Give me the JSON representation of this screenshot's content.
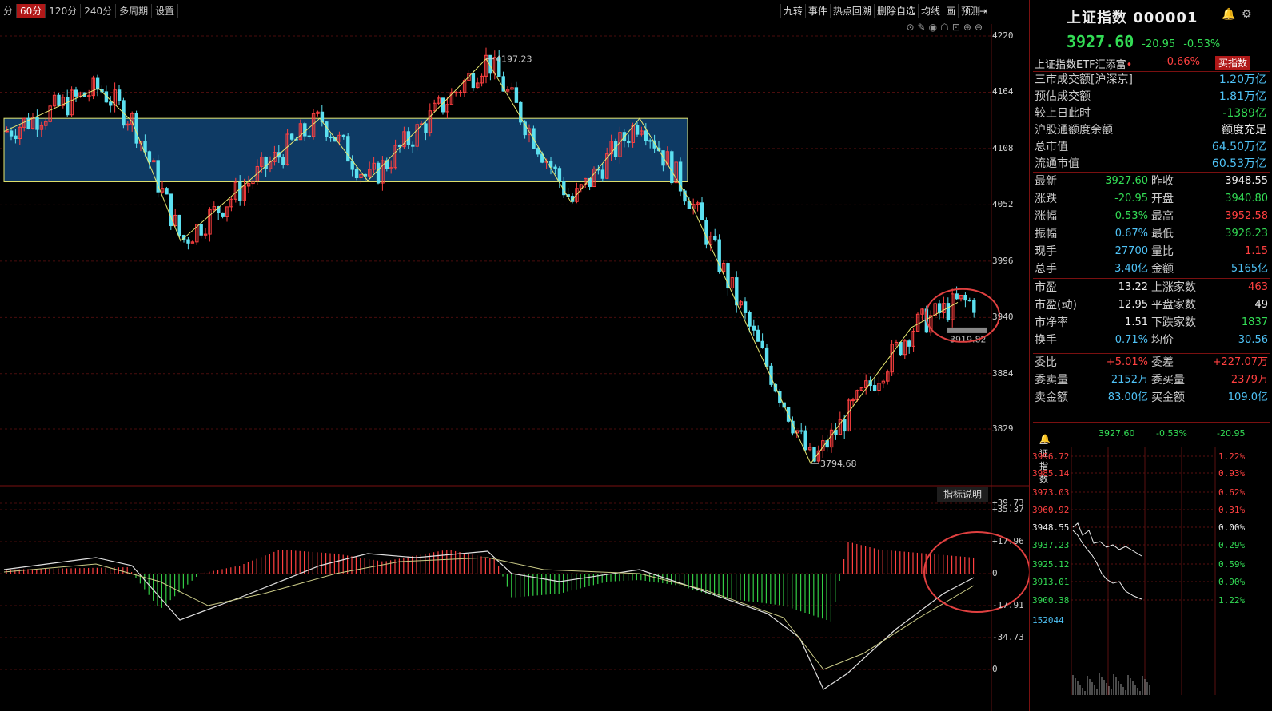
{
  "period_tabs": [
    {
      "label": "分"
    },
    {
      "label": "60分",
      "active": true
    },
    {
      "label": "120分"
    },
    {
      "label": "240分"
    },
    {
      "label": "多周期"
    },
    {
      "label": "设置"
    }
  ],
  "tool_tabs": [
    "九转",
    "事件",
    "热点回溯",
    "删除自选",
    "均线",
    "画",
    "预测"
  ],
  "tool_icons": [
    "⊙",
    "✎",
    "◉",
    "☖",
    "⊡",
    "⊕",
    "⊖"
  ],
  "price_axis": [
    "4220",
    "4164",
    "4108",
    "4052",
    "3996",
    "3940",
    "3884",
    "3829"
  ],
  "annotations": {
    "high": "4197.23",
    "low": "3794.68",
    "current_tag": "3919.82"
  },
  "indicator_axis": [
    "39.73",
    "35.37",
    "17.96",
    "0",
    "-17.91",
    "-34.73",
    "0"
  ],
  "indicator_button": "指标说明",
  "quote": {
    "title": "上证指数 000001",
    "price": "3927.60",
    "change": "-20.95",
    "change_pct": "-0.53%"
  },
  "etf": {
    "name": "上证指数ETF汇添富",
    "dot": "•",
    "change_pct": "-0.66%",
    "buy_label": "买指数"
  },
  "market_block": [
    {
      "k": "三市成交额[沪深京]",
      "v": "1.20万亿",
      "c": "cyan"
    },
    {
      "k": "预估成交额",
      "v": "1.81万亿",
      "c": "cyan"
    },
    {
      "k": "较上日此时",
      "v": "-1389亿",
      "c": "green"
    },
    {
      "k": "沪股通额度余额",
      "v": "额度充足",
      "c": "white"
    },
    {
      "k": "总市值",
      "v": "64.50万亿",
      "c": "cyan"
    },
    {
      "k": "流通市值",
      "v": "60.53万亿",
      "c": "cyan"
    }
  ],
  "stats_block": [
    {
      "k1": "最新",
      "v1": "3927.60",
      "c1": "green",
      "k2": "昨收",
      "v2": "3948.55",
      "c2": "white"
    },
    {
      "k1": "涨跌",
      "v1": "-20.95",
      "c1": "green",
      "k2": "开盘",
      "v2": "3940.80",
      "c2": "green"
    },
    {
      "k1": "涨幅",
      "v1": "-0.53%",
      "c1": "green",
      "k2": "最高",
      "v2": "3952.58",
      "c2": "red"
    },
    {
      "k1": "振幅",
      "v1": "0.67%",
      "c1": "cyan",
      "k2": "最低",
      "v2": "3926.23",
      "c2": "green"
    },
    {
      "k1": "现手",
      "v1": "27700",
      "c1": "cyan",
      "k2": "量比",
      "v2": "1.15",
      "c2": "red"
    },
    {
      "k1": "总手",
      "v1": "3.40亿",
      "c1": "cyan",
      "k2": "金额",
      "v2": "5165亿",
      "c2": "cyan"
    }
  ],
  "valuation_block": [
    {
      "k1": "市盈",
      "v1": "13.22",
      "c1": "white",
      "k2": "上涨家数",
      "v2": "463",
      "c2": "red"
    },
    {
      "k1": "市盈(动)",
      "v1": "12.95",
      "c1": "white",
      "k2": "平盘家数",
      "v2": "49",
      "c2": "white"
    },
    {
      "k1": "市净率",
      "v1": "1.51",
      "c1": "white",
      "k2": "下跌家数",
      "v2": "1837",
      "c2": "green"
    },
    {
      "k1": "换手",
      "v1": "0.71%",
      "c1": "cyan",
      "k2": "均价",
      "v2": "30.56",
      "c2": "cyan"
    }
  ],
  "order_block": [
    {
      "k1": "委比",
      "v1": "+5.01%",
      "c1": "red",
      "k2": "委差",
      "v2": "+227.07万",
      "c2": "red"
    },
    {
      "k1": "委卖量",
      "v1": "2152万",
      "c1": "cyan",
      "k2": "委买量",
      "v2": "2379万",
      "c2": "red"
    },
    {
      "k1": "卖金额",
      "v1": "83.00亿",
      "c1": "cyan",
      "k2": "买金额",
      "v2": "109.0亿",
      "c2": "cyan"
    }
  ],
  "mini_chart": {
    "name": "上证指数",
    "price": "3927.60",
    "change_pct": "-0.53%",
    "change": "-20.95",
    "left_axis": [
      "3996.72",
      "3985.14",
      "3973.03",
      "3960.92",
      "3948.55",
      "3937.23",
      "3925.12",
      "3913.01",
      "3900.38",
      "152044"
    ],
    "right_axis": [
      "1.22%",
      "0.93%",
      "0.62%",
      "0.31%",
      "0.00%",
      "0.29%",
      "0.59%",
      "0.90%",
      "1.22%"
    ]
  },
  "colors": {
    "up": "#ff4040",
    "down": "#5ce0f0",
    "band": "#0e3a64",
    "zigzag": "#e8e870",
    "ma": "#e0e0e0"
  }
}
